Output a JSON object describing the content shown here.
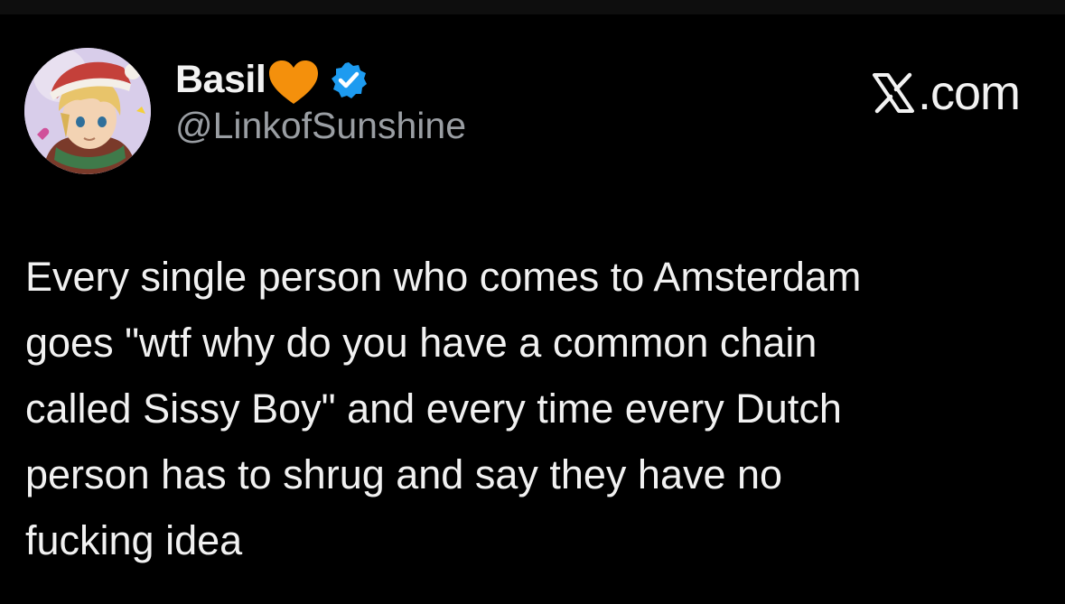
{
  "author": {
    "display_name": "Basil",
    "handle": "@LinkofSunshine",
    "emoji_icon": "orange-heart-icon",
    "verified_icon": "verified-badge-icon",
    "avatar_icon": "profile-avatar"
  },
  "watermark": {
    "label": ".com",
    "logo_icon": "x-logo-icon"
  },
  "tweet": {
    "lines": [
      "Every single person who comes to Amsterdam",
      "goes \"wtf why do you have a common chain",
      "called Sissy Boy\" and every time every Dutch",
      "person has to shrug and say they have no",
      "fucking idea"
    ]
  },
  "colors": {
    "background": "#000000",
    "primary_text": "#f1f1f1",
    "secondary_text": "#9a9ea3",
    "verified_blue": "#1d9bf0",
    "heart_orange": "#f4900c"
  }
}
